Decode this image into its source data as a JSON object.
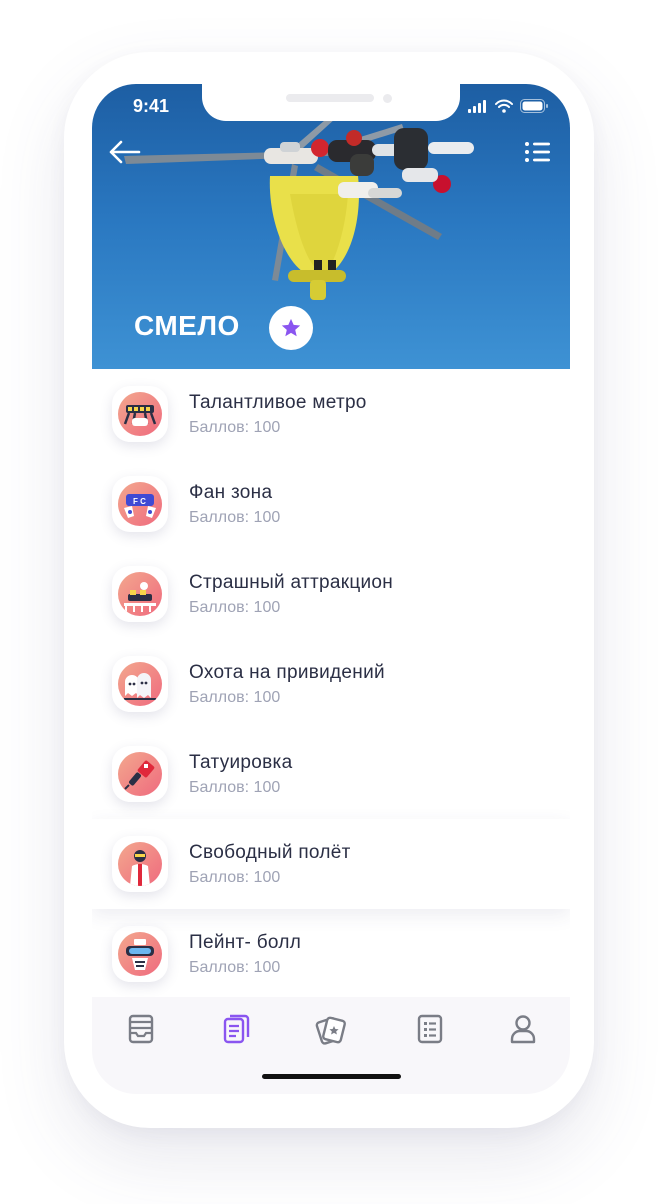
{
  "status_bar": {
    "time": "9:41"
  },
  "header": {
    "category_title": "СМЕЛО"
  },
  "activities": [
    {
      "title": "Талантливое метро",
      "points": "Баллов: 100",
      "icon": "metro-icon"
    },
    {
      "title": "Фан зона",
      "points": "Баллов: 100",
      "icon": "fan-zone-icon"
    },
    {
      "title": "Страшный аттракцион",
      "points": "Баллов: 100",
      "icon": "roller-coaster-icon"
    },
    {
      "title": "Охота на привидений",
      "points": "Баллов: 100",
      "icon": "ghosts-icon"
    },
    {
      "title": "Татуировка",
      "points": "Баллов: 100",
      "icon": "tattoo-machine-icon"
    },
    {
      "title": "Свободный полёт",
      "points": "Баллов: 100",
      "icon": "skydiver-icon"
    },
    {
      "title": "Пейнт- болл",
      "points": "Баллов: 100",
      "icon": "paintball-mask-icon"
    }
  ],
  "tabbar": {
    "items": [
      "inbox-icon",
      "documents-icon",
      "cards-icon",
      "checklist-icon",
      "profile-icon"
    ],
    "active": "documents-icon"
  },
  "colors": {
    "accent": "#8a55f0",
    "sky": "#2a78c1",
    "icon_gradient_start": "#f2a88e",
    "icon_gradient_end": "#f06a7e",
    "title_text": "#2b2f45",
    "subtitle_text": "#9fa3b5",
    "tab_inactive": "#7a7d86"
  }
}
